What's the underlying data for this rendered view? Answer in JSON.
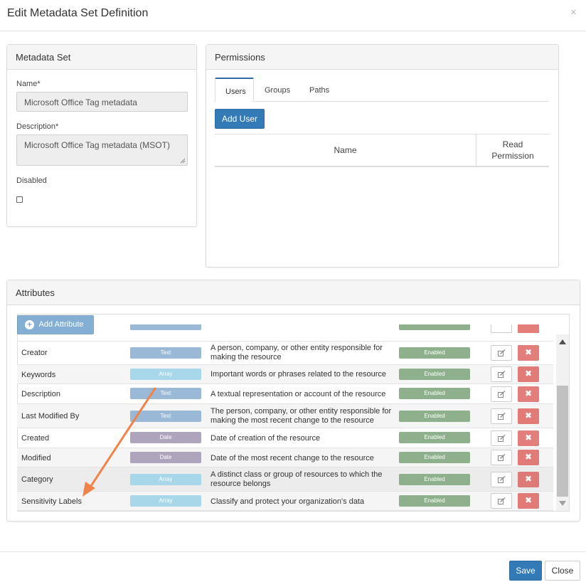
{
  "dialog": {
    "title": "Edit Metadata Set Definition",
    "close_symbol": "×"
  },
  "metadata_set": {
    "heading": "Metadata Set",
    "name_label": "Name*",
    "name_value": "Microsoft Office Tag metadata",
    "description_label": "Description*",
    "description_value": "Microsoft Office Tag metadata (MSOT)",
    "disabled_label": "Disabled",
    "disabled_checked": false
  },
  "permissions": {
    "heading": "Permissions",
    "tabs": [
      {
        "label": "Users",
        "active": true
      },
      {
        "label": "Groups",
        "active": false
      },
      {
        "label": "Paths",
        "active": false
      }
    ],
    "add_user_label": "Add User",
    "columns": {
      "name": "Name",
      "read_line1": "Read",
      "read_line2": "Permission"
    }
  },
  "attributes": {
    "heading": "Attributes",
    "add_label": "Add Attribute",
    "rows": [
      {
        "name": "Creator",
        "type": "Text",
        "description": "A person, company, or other entity responsible for making the resource",
        "status": "Enabled"
      },
      {
        "name": "Keywords",
        "type": "Array",
        "description": "Important words or phrases related to the resource",
        "status": "Enabled"
      },
      {
        "name": "Description",
        "type": "Text",
        "description": "A textual representation or account of the resource",
        "status": "Enabled"
      },
      {
        "name": "Last Modified By",
        "type": "Text",
        "description": "The person, company, or other entity responsible for making the most recent change to the resource",
        "status": "Enabled"
      },
      {
        "name": "Created",
        "type": "Date",
        "description": "Date of creation of the resource",
        "status": "Enabled"
      },
      {
        "name": "Modified",
        "type": "Date",
        "description": "Date of the most recent change to the resource",
        "status": "Enabled"
      },
      {
        "name": "Category",
        "type": "Array",
        "description": "A distinct class or group of resources to which the resource belongs",
        "status": "Enabled"
      },
      {
        "name": "Sensitivity Labels",
        "type": "Array",
        "description": "Classify and protect your organization's data",
        "status": "Enabled"
      }
    ],
    "delete_symbol": "✖"
  },
  "footer": {
    "save_label": "Save",
    "close_label": "Close"
  },
  "colors": {
    "primary": "#337ab7",
    "enabled": "#8fb08c",
    "danger": "#d9534f",
    "annotation_arrow": "#f0834a"
  }
}
